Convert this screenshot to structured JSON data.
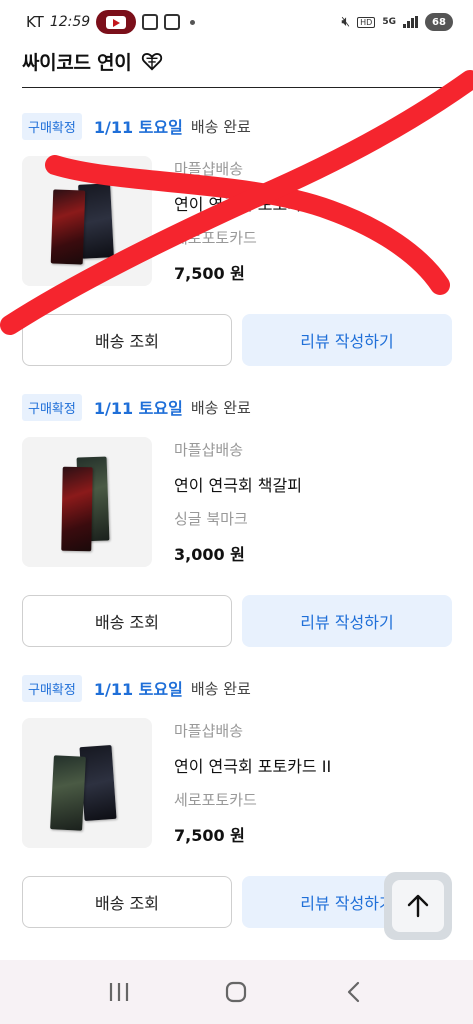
{
  "status_bar": {
    "carrier": "KT",
    "time": "12:59",
    "hd_label": "HD",
    "network": "5G",
    "battery": "68"
  },
  "header": {
    "title": "싸이코드 연이"
  },
  "orders": [
    {
      "badge": "구매확정",
      "date": "1/11 토요일",
      "delivery_status": "배송 완료",
      "shipping": "마플샵배송",
      "product_name": "연이 연극회 포토카드 I",
      "option": "세로포토카드",
      "price": "7,500 원",
      "track_label": "배송 조회",
      "review_label": "리뷰 작성하기"
    },
    {
      "badge": "구매확정",
      "date": "1/11 토요일",
      "delivery_status": "배송 완료",
      "shipping": "마플샵배송",
      "product_name": "연이 연극회 책갈피",
      "option": "싱글 북마크",
      "price": "3,000 원",
      "track_label": "배송 조회",
      "review_label": "리뷰 작성하기"
    },
    {
      "badge": "구매확정",
      "date": "1/11 토요일",
      "delivery_status": "배송 완료",
      "shipping": "마플샵배송",
      "product_name": "연이 연극회 포토카드 II",
      "option": "세로포토카드",
      "price": "7,500 원",
      "track_label": "배송 조회",
      "review_label": "리뷰 작성하기"
    }
  ],
  "colors": {
    "accent": "#1f6fd8",
    "badge_bg": "#e8f1fd",
    "strike": "#f5252e"
  }
}
